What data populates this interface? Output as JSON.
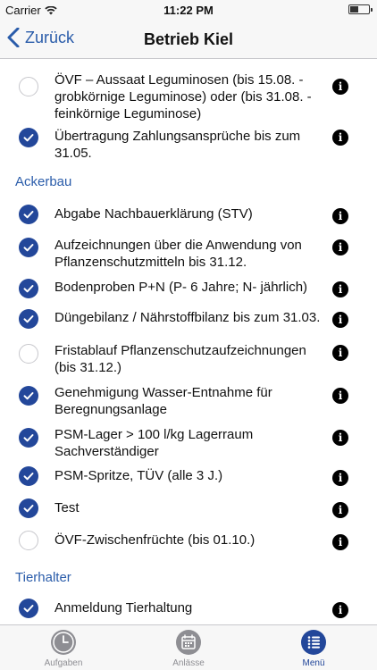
{
  "status": {
    "carrier": "Carrier",
    "time": "11:22 PM"
  },
  "nav": {
    "back_label": "Zurück",
    "title": "Betrieb Kiel"
  },
  "sections": [
    {
      "header": "",
      "items": [
        {
          "text": "ÖVF – Aussaat Leguminosen (bis 15.08. - grobkörnige Leguminose) oder (bis 31.08. - feinkörnige Leguminose)",
          "checked": false
        },
        {
          "text": "Übertragung Zahlungsansprüche bis zum 31.05.",
          "checked": true
        }
      ]
    },
    {
      "header": "Ackerbau",
      "items": [
        {
          "text": "Abgabe Nachbauerklärung (STV)",
          "checked": true
        },
        {
          "text": "Aufzeichnungen über die Anwendung von Pflanzenschutzmitteln bis 31.12.",
          "checked": true
        },
        {
          "text": "Bodenproben P+N (P- 6 Jahre; N- jährlich)",
          "checked": true
        },
        {
          "text": "Düngebilanz / Nährstoffbilanz bis zum 31.03.",
          "checked": true
        },
        {
          "text": "Fristablauf Pflanzenschutzaufzeichnungen (bis 31.12.)",
          "checked": false
        },
        {
          "text": "Genehmigung Wasser-Entnahme für Beregnungsanlage",
          "checked": true
        },
        {
          "text": "PSM-Lager > 100 l/kg Lagerraum Sachverständiger",
          "checked": true
        },
        {
          "text": "PSM-Spritze, TÜV (alle 3 J.)",
          "checked": true
        },
        {
          "text": "Test",
          "checked": true
        },
        {
          "text": "ÖVF-Zwischenfrüchte (bis 01.10.)",
          "checked": false
        }
      ]
    },
    {
      "header": "Tierhalter",
      "items": [
        {
          "text": "Anmeldung Tierhaltung",
          "checked": true
        }
      ]
    }
  ],
  "info_glyph": "i",
  "tabs": [
    {
      "label": "Aufgaben",
      "icon": "clock-icon",
      "active": false
    },
    {
      "label": "Anlässe",
      "icon": "calendar-icon",
      "active": false
    },
    {
      "label": "Menü",
      "icon": "list-icon",
      "active": true
    }
  ],
  "colors": {
    "accent": "#23479a",
    "link": "#2a5caa",
    "inactive": "#8e8e93"
  }
}
